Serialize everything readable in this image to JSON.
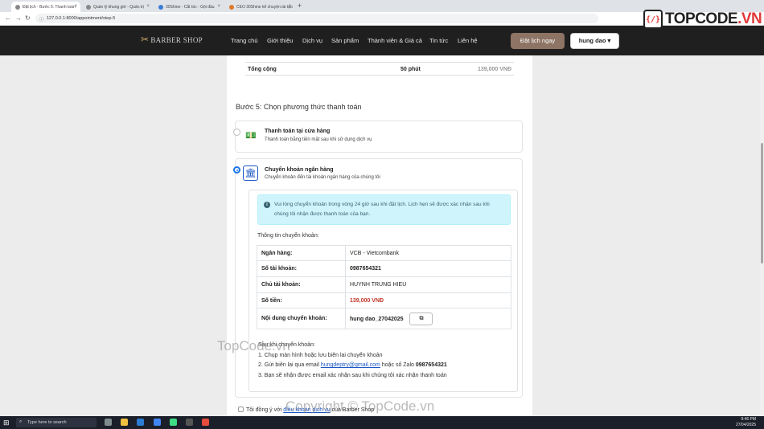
{
  "browser": {
    "tabs": [
      {
        "label": "Đặt lịch - Bước 5: Thanh toán"
      },
      {
        "label": "Quản lý khung giờ - Quản trị"
      },
      {
        "label": "30Shine - Cắt tóc - Gội đầu"
      },
      {
        "label": "CEO 30Shine kể chuyện tái tạo"
      }
    ],
    "url": "127.0.0.1:8000/appointment/step-5"
  },
  "watermark": {
    "logo_text": "TOPCODE",
    "logo_suffix": ".VN",
    "text_center": "TopCode.vn",
    "text_bottom": "Copyright © TopCode.vn"
  },
  "header": {
    "brand": "BARBER SHOP",
    "nav": [
      "Trang chủ",
      "Giới thiệu",
      "Dịch vụ",
      "Sản phẩm",
      "Thành viên & Giá cả",
      "Tin tức",
      "Liên hệ"
    ],
    "book_button": "Đặt lịch ngay",
    "user_button": "hung dao"
  },
  "summary": {
    "label": "Tổng cộng",
    "duration": "50 phút",
    "price": "139,000 VNĐ"
  },
  "step": {
    "title": "Bước 5: Chọn phương thức thanh toán",
    "options": [
      {
        "title": "Thanh toán tại cửa hàng",
        "desc": "Thanh toán bằng tiền mặt sau khi sử dụng dịch vụ",
        "selected": false
      },
      {
        "title": "Chuyển khoản ngân hàng",
        "desc": "Chuyển khoản đến tài khoản ngân hàng của chúng tôi",
        "selected": true
      }
    ]
  },
  "bank": {
    "alert": "Vui lòng chuyển khoản trong vòng 24 giờ sau khi đặt lịch. Lịch hẹn sẽ được xác nhận sau khi chúng tôi nhận được thanh toán của bạn.",
    "section_label": "Thông tin chuyển khoản:",
    "rows": [
      {
        "key": "Ngân hàng:",
        "value": "VCB - Vietcombank"
      },
      {
        "key": "Số tài khoản:",
        "value": "0987654321"
      },
      {
        "key": "Chủ tài khoản:",
        "value": "HUYNH TRUNG HIEU"
      },
      {
        "key": "Số tiền:",
        "value": "139,000 VNĐ"
      },
      {
        "key": "Nội dung chuyển khoản:",
        "value": "hung dao_27042025"
      }
    ],
    "instructions_title": "Sau khi chuyển khoản:",
    "instr1": "1. Chụp màn hình hoặc lưu biên lai chuyển khoản",
    "instr2_prefix": "2. Gửi biên lai qua email ",
    "instr2_email": "hungdeptry@gmail.com",
    "instr2_mid": " hoặc số Zalo ",
    "instr2_phone": "0987654321",
    "instr3": "3. Bạn sẽ nhận được email xác nhận sau khi chúng tôi xác nhận thanh toán"
  },
  "agree": {
    "prefix": "Tôi đồng ý với ",
    "link": "điều khoản dịch vụ",
    "suffix": " của Barber Shop"
  },
  "taskbar": {
    "search_placeholder": "Type here to search",
    "time": "9:46 PM",
    "date": "27/04/2025"
  }
}
